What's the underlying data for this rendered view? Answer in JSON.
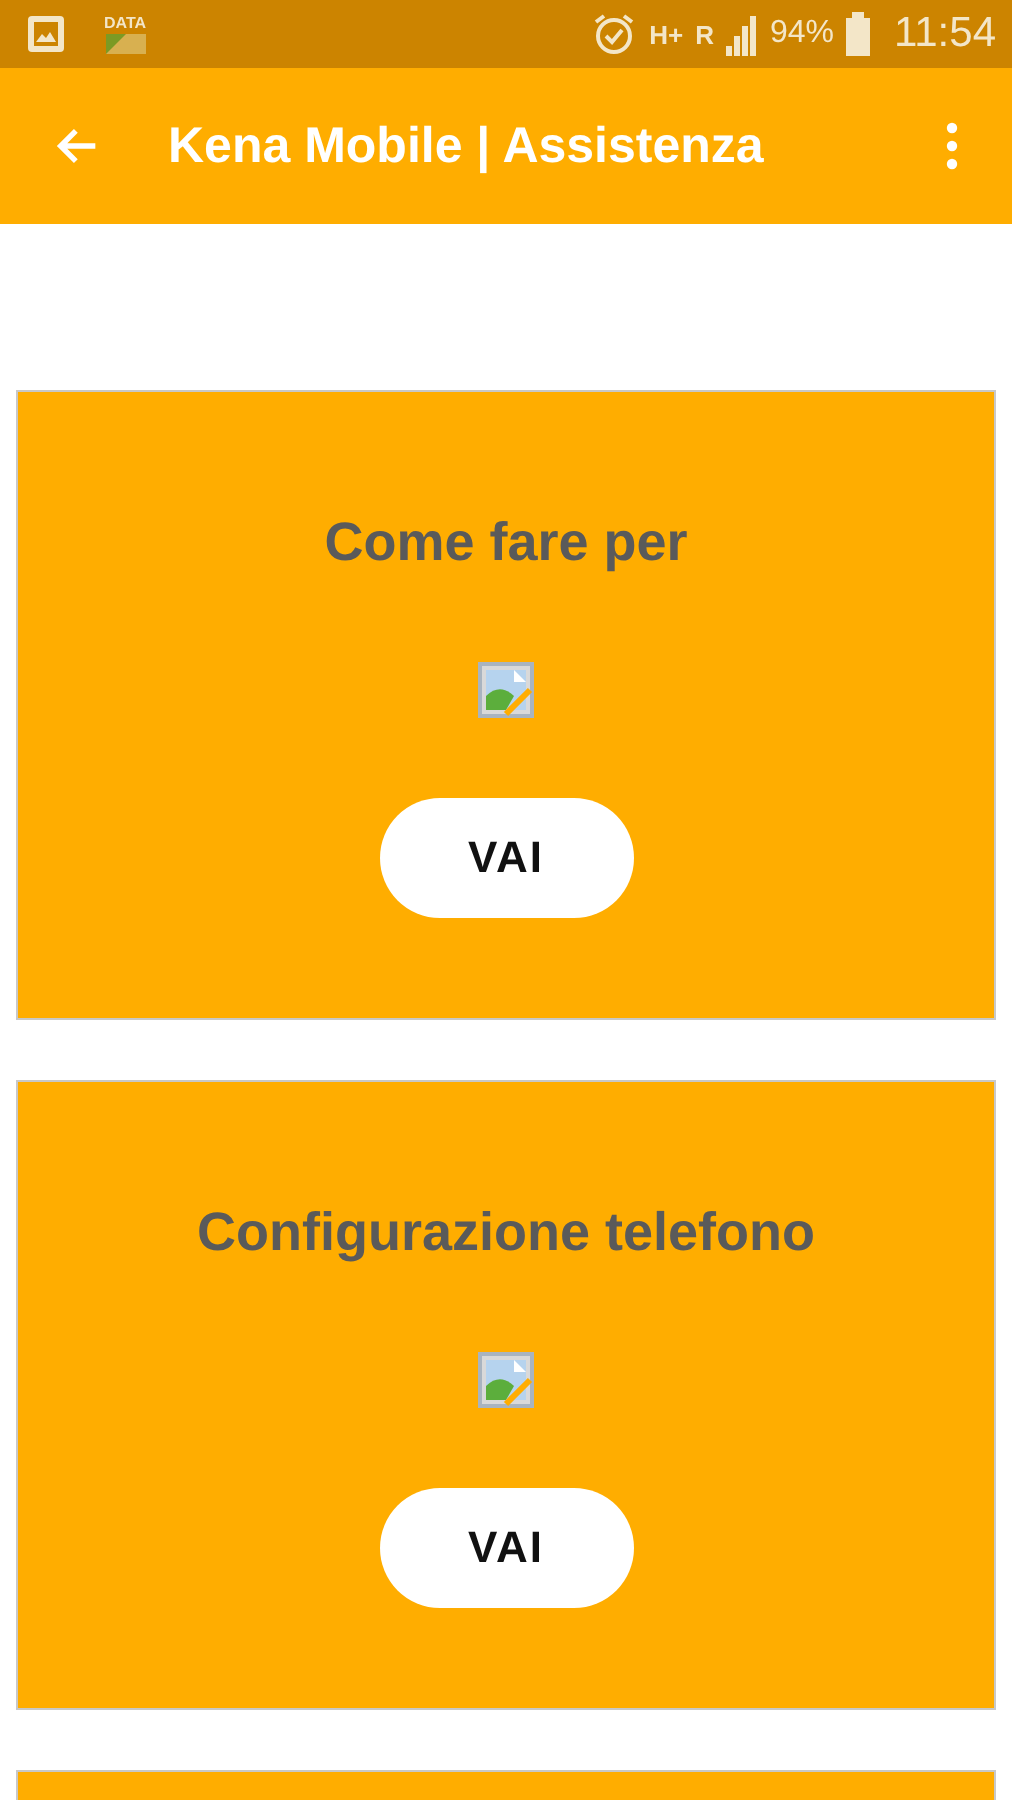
{
  "status_bar": {
    "data_label": "DATA",
    "network": "H+",
    "roaming": "R",
    "battery": "94%",
    "time": "11:54"
  },
  "app_bar": {
    "title": "Kena Mobile | Assistenza"
  },
  "cards": [
    {
      "kind": "card",
      "title": "Come fare per",
      "button": "VAI"
    },
    {
      "kind": "card",
      "title": "Configurazione telefono",
      "button": "VAI"
    },
    {
      "kind": "partial"
    }
  ]
}
